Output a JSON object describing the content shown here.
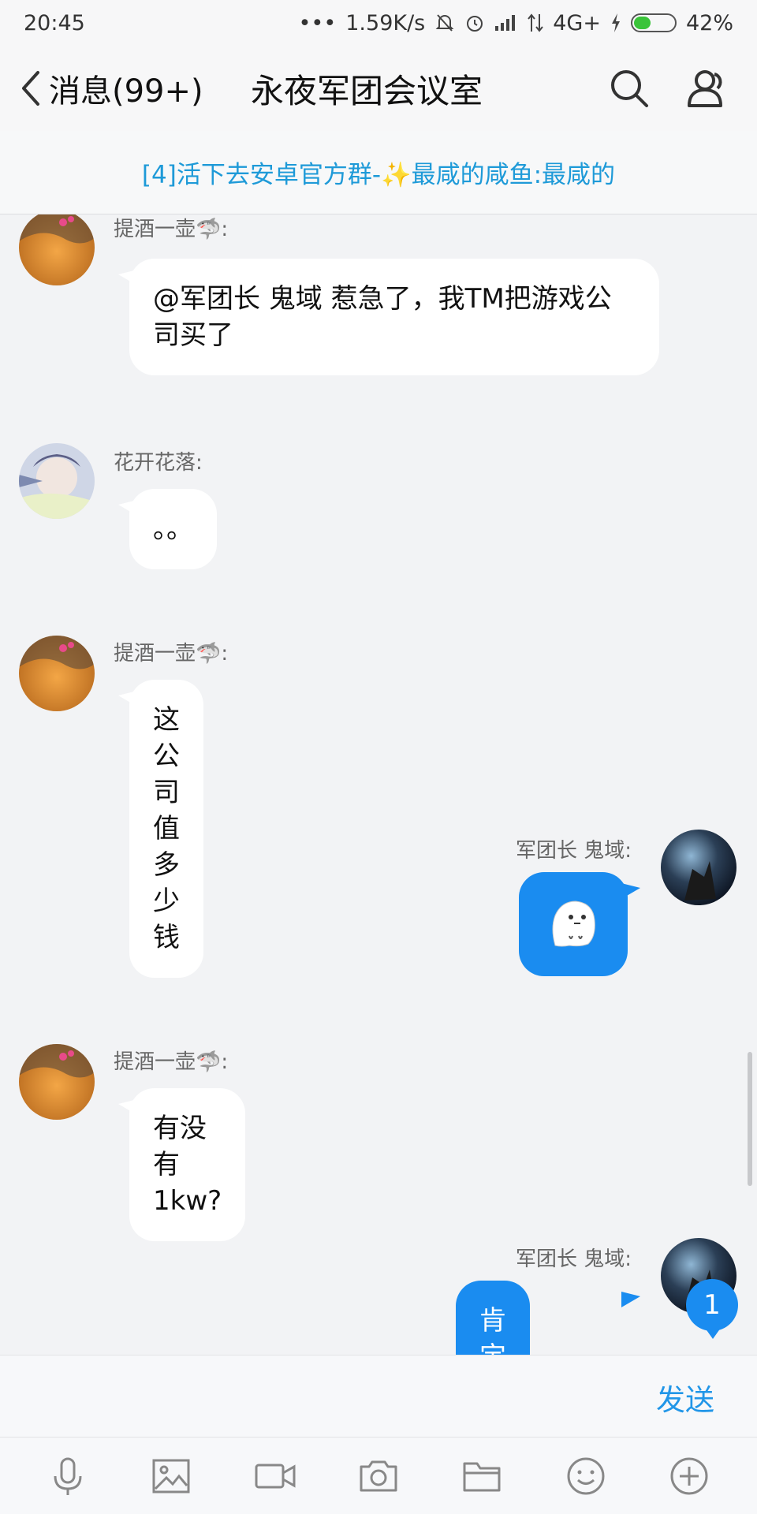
{
  "status_bar": {
    "time": "20:45",
    "dots": "•••",
    "net_speed": "1.59K/s",
    "network": "4G+",
    "battery_pct": "42%",
    "battery_level": 0.42
  },
  "header": {
    "back_label": "消息(99+)",
    "title": "永夜军团会议室"
  },
  "pinned": {
    "text": "[4]活下去安卓官方群-✨最咸的咸鱼:最咸的"
  },
  "messages": [
    {
      "nick": "提酒一壶🦈:",
      "text": "@军团长 鬼域 惹急了，我TM把游戏公司买了"
    },
    {
      "nick": "花开花落:",
      "text": "。。"
    },
    {
      "nick": "提酒一壶🦈:",
      "text": "这公司值多少钱"
    },
    {
      "nick": "军团长 鬼域:",
      "text": ""
    },
    {
      "nick": "提酒一壶🦈:",
      "text": "有没有1kw?"
    },
    {
      "nick": "军团长 鬼域:",
      "text": "肯定没得"
    }
  ],
  "unread_badge": "1",
  "input": {
    "placeholder": "",
    "send_label": "发送"
  },
  "colors": {
    "accent": "#1a8cf0",
    "pinned_text": "#1e9ad8",
    "background": "#f2f3f5"
  }
}
